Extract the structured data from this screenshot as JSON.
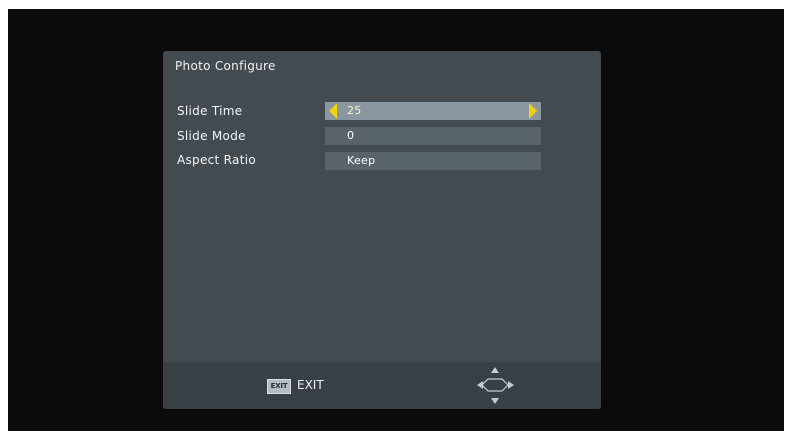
{
  "panel": {
    "title": "Photo Configure",
    "items": [
      {
        "label": "Slide Time",
        "value": "25",
        "selected": true
      },
      {
        "label": "Slide Mode",
        "value": "0",
        "selected": false
      },
      {
        "label": "Aspect Ratio",
        "value": "Keep",
        "selected": false
      }
    ]
  },
  "footer": {
    "exit_button_label": "EXIT",
    "exit_label": "EXIT",
    "nav_icon": "directional-pad-icon"
  },
  "colors": {
    "panel_bg": "#434b51",
    "selected_bg": "#8a96a0",
    "unselected_bg": "#59636a",
    "arrow_yellow": "#f2d20f"
  }
}
